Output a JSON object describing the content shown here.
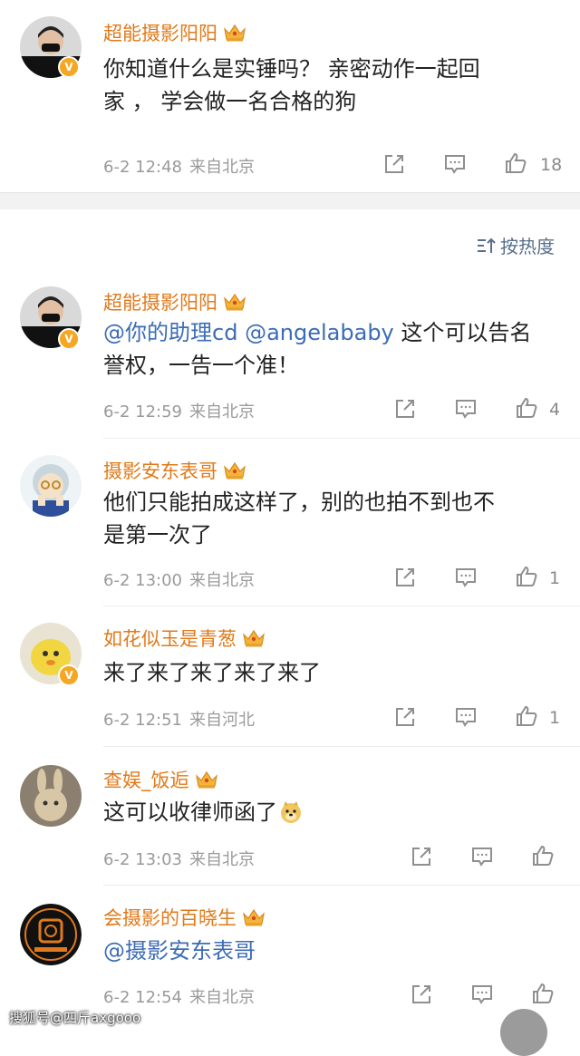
{
  "top_post": {
    "author": "超能摄影阳阳",
    "text_line1": "你知道什么是实锤吗？ 亲密动作一起回",
    "text_line2": "家 ， 学会做一名合格的狗",
    "time": "6-2 12:48",
    "source": "来自北京",
    "like_count": "18"
  },
  "sort_label": "按热度",
  "comments": [
    {
      "author": "超能摄影阳阳",
      "mention1": "@你的助理cd",
      "mention2": "@angelababy",
      "text_rest": " 这个可以告名",
      "text_line2": "誉权，一告一个准！",
      "time": "6-2 12:59",
      "source": "来自北京",
      "like_count": "4"
    },
    {
      "author": "摄影安东表哥",
      "text_line1": "他们只能拍成这样了，别的也拍不到也不",
      "text_line2": "是第一次了",
      "time": "6-2 13:00",
      "source": "来自北京",
      "like_count": "1"
    },
    {
      "author": "如花似玉是青葱",
      "text_line1": "来了来了来了来了来了",
      "time": "6-2 12:51",
      "source": "来自河北",
      "like_count": "1"
    },
    {
      "author": "查娱_饭逅",
      "text_line1": "这可以收律师函了",
      "time": "6-2 13:03",
      "source": "来自北京",
      "like_count": ""
    },
    {
      "author": "会摄影的百晓生",
      "mention1": "@摄影安东表哥",
      "time": "6-2 12:54",
      "source": "来自北京",
      "like_count": ""
    }
  ],
  "watermark": "搜狐号@四斤axgooo",
  "colors": {
    "name": "#e07a1a",
    "mention": "#3c6cb5",
    "badge": "#f5a623",
    "meta": "#9a9a9a"
  },
  "icons": [
    "crown-icon",
    "share-icon",
    "comment-icon",
    "like-icon",
    "verified-badge-icon",
    "sort-icon"
  ]
}
